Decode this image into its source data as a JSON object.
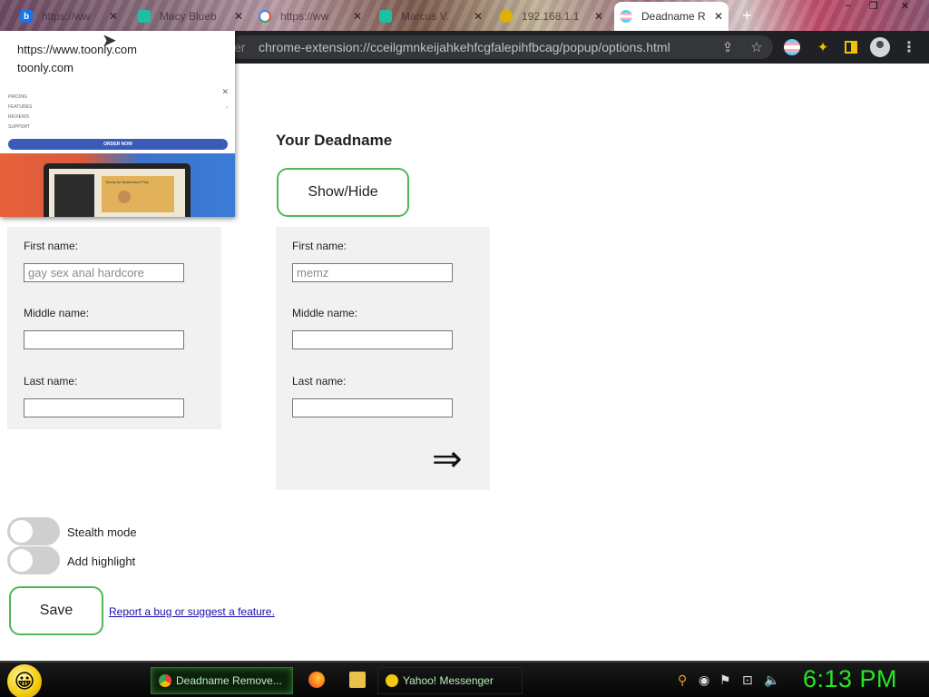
{
  "browser": {
    "tabs": [
      {
        "label": "https://ww",
        "icon": "b-favicon"
      },
      {
        "label": "Macy Blueb",
        "icon": "bolt-favicon"
      },
      {
        "label": "https://ww",
        "icon": "google-favicon"
      },
      {
        "label": "Marcus V.",
        "icon": "bolt-favicon"
      },
      {
        "label": "192.168.1.1",
        "icon": "router-favicon"
      },
      {
        "label": "Deadname R",
        "icon": "trans-flag-favicon",
        "active": true
      }
    ],
    "new_tab": "+",
    "window_controls": [
      "–",
      "❐",
      "✕"
    ],
    "address_fragment": "er",
    "address": "chrome-extension://cceilgmnkeijahkehfcgfalepihfbcag/popup/options.html"
  },
  "popup_preview": {
    "url": "https://www.toonly.com",
    "domain": "toonly.com",
    "thumbnail": {
      "menu_items": [
        "Pricing",
        "Features",
        "Reviews",
        "Support"
      ],
      "close": "✕",
      "order_button": "ORDER NOW",
      "card_text": "Toonly for Businesses Plus"
    }
  },
  "page": {
    "heading": "Your Deadname",
    "show_hide_button": "Show/Hide",
    "left_panel": {
      "first_label": "First name:",
      "first_placeholder": "gay sex anal hardcore",
      "middle_label": "Middle name:",
      "last_label": "Last name:"
    },
    "right_panel": {
      "first_label": "First name:",
      "first_placeholder": "memz",
      "middle_label": "Middle name:",
      "last_label": "Last name:",
      "arrow": "⇒"
    },
    "stealth_label": "Stealth mode",
    "stealth_on": false,
    "highlight_label": "Add highlight",
    "highlight_on": false,
    "save_button": "Save",
    "report_link": "Report a bug or suggest a feature."
  },
  "taskbar": {
    "tasks": [
      {
        "label": "Deadname Remove...",
        "icon": "chrome-icon"
      },
      {
        "label": "Yahoo! Messenger",
        "icon": "yahoo-messenger-icon"
      }
    ],
    "clock": "6:13 PM"
  },
  "colors": {
    "accent_green": "#52b55a",
    "panel_bg": "#f1f1f1",
    "clock_green": "#27e627"
  }
}
